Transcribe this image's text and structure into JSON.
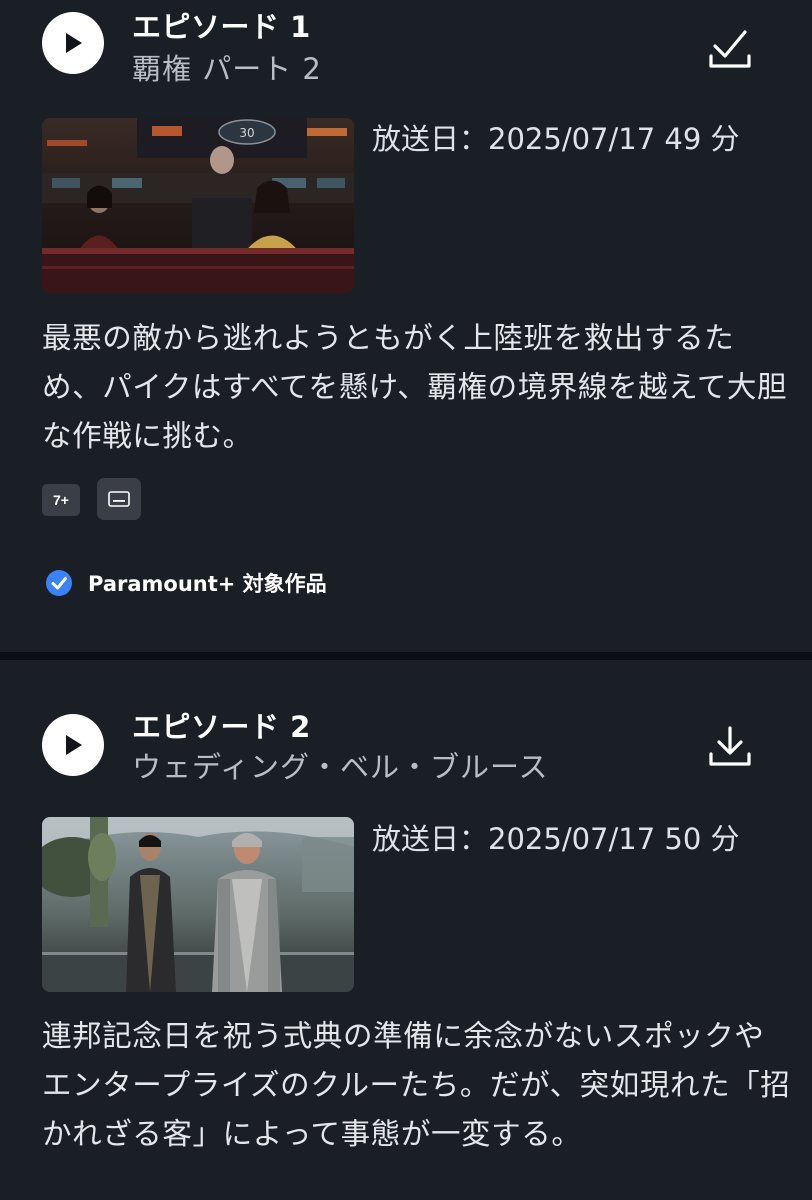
{
  "episodes": [
    {
      "title": "エピソード 1",
      "subtitle": "覇権 パート 2",
      "download_state": "downloaded",
      "download_icon": "check-download-icon",
      "air_date_label": "放送日：",
      "air_date": "2025/07/17",
      "duration": "49 分",
      "description": "最悪の敵から逃れようともがく上陸班を救出するため、パイクはすべてを懸け、覇権の境界線を越えて大胆な作戦に挑む。",
      "rating_badge": "7+",
      "has_subtitles": true,
      "paramount_label": "Paramount+ 対象作品"
    },
    {
      "title": "エピソード 2",
      "subtitle": "ウェディング・ベル・ブルース",
      "download_state": "available",
      "download_icon": "download-icon",
      "air_date_label": "放送日：",
      "air_date": "2025/07/17",
      "duration": "50 分",
      "description": "連邦記念日を祝う式典の準備に余念がないスポックやエンタープライズのクルーたち。だが、突如現れた「招かれざる客」によって事態が一変する。"
    }
  ],
  "colors": {
    "background": "#1a1f26",
    "divider": "#0b0e12",
    "badge_bg": "#3a3f47",
    "check_blue": "#3b82f6",
    "subtitle_text": "#b9bec6"
  }
}
